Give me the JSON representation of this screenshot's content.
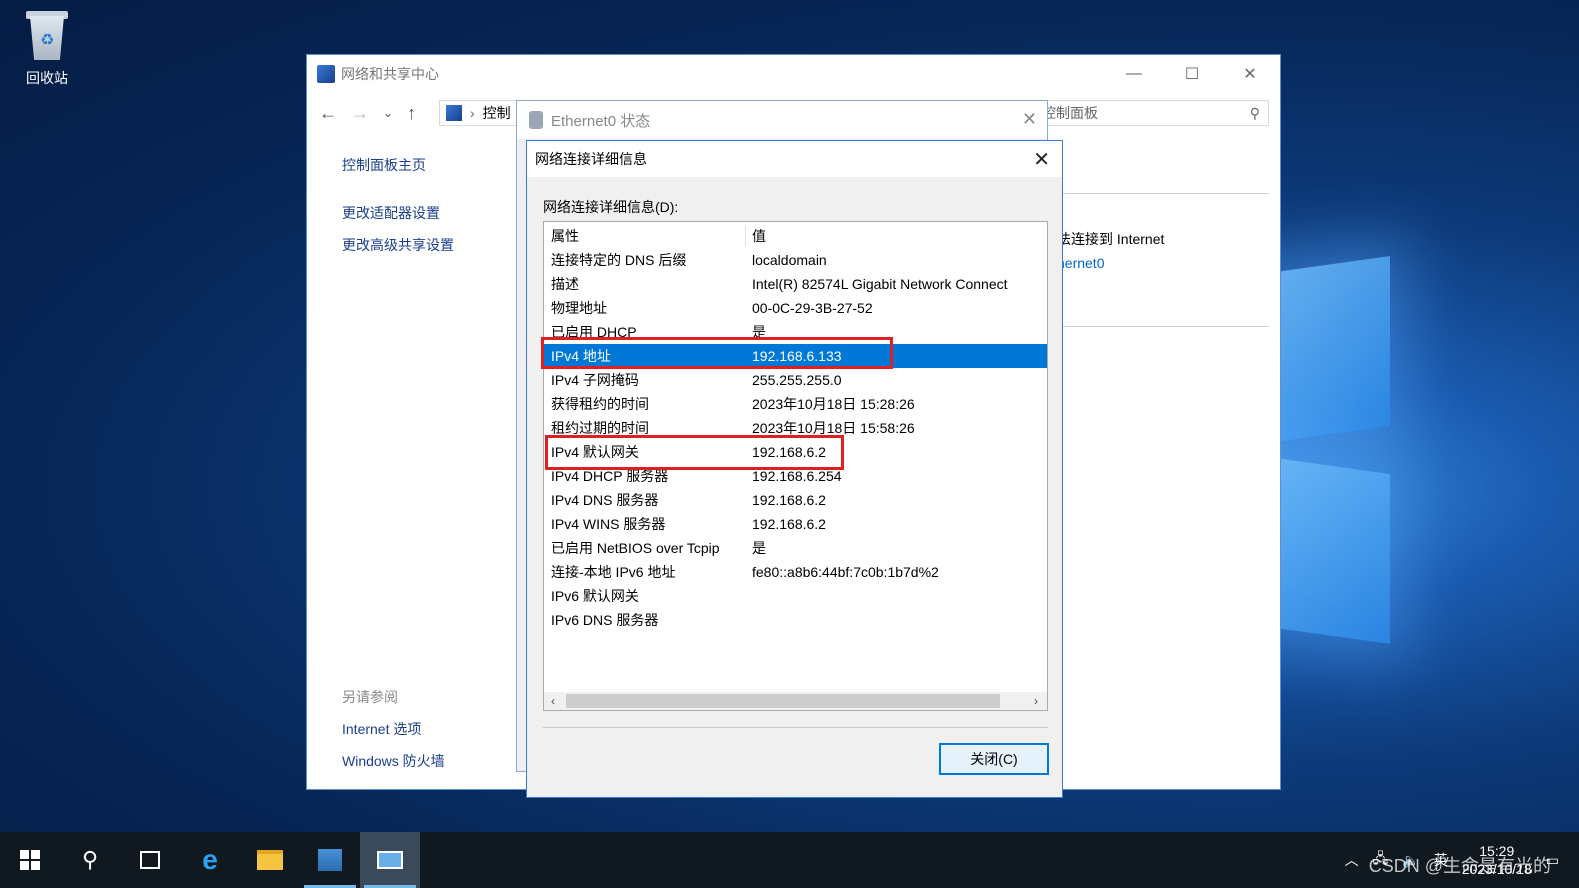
{
  "desktop": {
    "recycle_bin_label": "回收站"
  },
  "main_window": {
    "title": "网络和共享中心",
    "address_crumb": "控制",
    "search_placeholder": "索控制面板",
    "left_nav": [
      "控制面板主页",
      "更改适配器设置",
      "更改高级共享设置"
    ],
    "see_also_header": "另请参阅",
    "see_also": [
      "Internet 选项",
      "Windows 防火墙"
    ],
    "right_text_1": "法连接到 Internet",
    "right_link": "hernet0"
  },
  "eth_window": {
    "title": "Ethernet0 状态"
  },
  "dialog": {
    "title": "网络连接详细信息",
    "list_label": "网络连接详细信息(D):",
    "columns": [
      "属性",
      "值"
    ],
    "rows": [
      [
        "连接特定的 DNS 后缀",
        "localdomain"
      ],
      [
        "描述",
        "Intel(R) 82574L Gigabit Network Connect"
      ],
      [
        "物理地址",
        "00-0C-29-3B-27-52"
      ],
      [
        "已启用 DHCP",
        "是"
      ],
      [
        "IPv4 地址",
        "192.168.6.133"
      ],
      [
        "IPv4 子网掩码",
        "255.255.255.0"
      ],
      [
        "获得租约的时间",
        "2023年10月18日 15:28:26"
      ],
      [
        "租约过期的时间",
        "2023年10月18日 15:58:26"
      ],
      [
        "IPv4 默认网关",
        "192.168.6.2"
      ],
      [
        "IPv4 DHCP 服务器",
        "192.168.6.254"
      ],
      [
        "IPv4 DNS 服务器",
        "192.168.6.2"
      ],
      [
        "IPv4 WINS 服务器",
        "192.168.6.2"
      ],
      [
        "已启用 NetBIOS over Tcpip",
        "是"
      ],
      [
        "连接-本地 IPv6 地址",
        "fe80::a8b6:44bf:7c0b:1b7d%2"
      ],
      [
        "IPv6 默认网关",
        ""
      ],
      [
        "IPv6 DNS 服务器",
        ""
      ]
    ],
    "selected_row": 4,
    "close_button": "关闭(C)"
  },
  "taskbar": {
    "time": "15:29",
    "date": "2023/10/18",
    "ime": "英",
    "watermark": "CSDN @生命是有光的"
  },
  "colors": {
    "selection": "#0078d7",
    "highlight_box": "#e02020",
    "link": "#1a3e8c"
  }
}
